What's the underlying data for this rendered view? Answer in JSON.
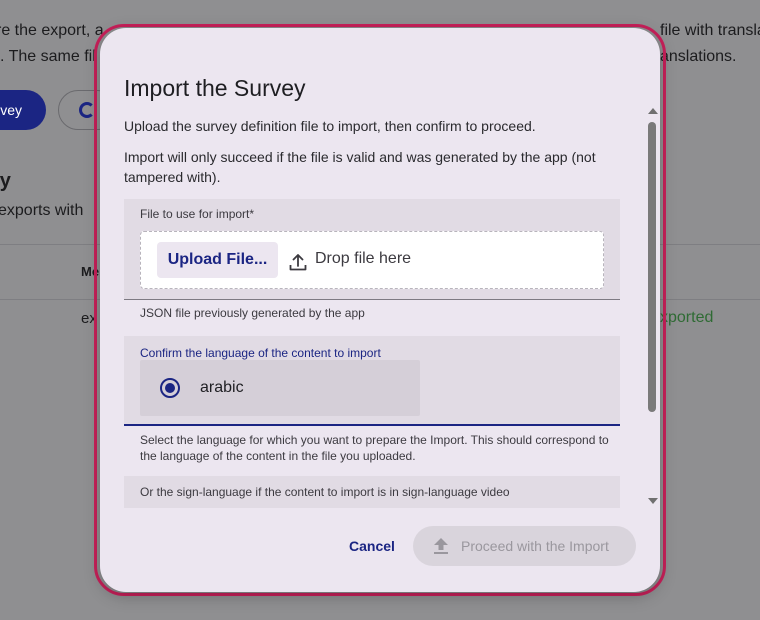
{
  "background": {
    "line1_left": "re the export, a",
    "line1_right": "file with transla",
    "line2_left": ". The same fil",
    "line2_right": "anslations.",
    "survey_button_label": "vey",
    "section_heading": "ry",
    "section_subtitle": "exports with",
    "column_header": "Me",
    "row_cell": "ex",
    "row_status": "xported"
  },
  "dialog": {
    "title": "Import the Survey",
    "intro": "Upload the survey definition file to import, then confirm to proceed.",
    "warning": "Import will only succeed if the file is valid and was generated by the app (not tampered with).",
    "file_field": {
      "label": "File to use for import*",
      "upload_button": "Upload File...",
      "drop_text": "Drop file here",
      "helper": "JSON file previously generated by the app"
    },
    "language_field": {
      "label": "Confirm the language of the content to import",
      "selected_option": "arabic",
      "helper": "Select the language for which you want to prepare the Import. This should correspond to the language of the content in the file you uploaded."
    },
    "sign_language_field": {
      "label": "Or the sign-language if the content to import is in sign-language video"
    },
    "actions": {
      "cancel": "Cancel",
      "proceed": "Proceed with the Import"
    }
  },
  "colors": {
    "accent": "#1b2583",
    "highlight_border": "#c8205a",
    "success_text": "#2f6b34",
    "dialog_bg": "#ece6f0"
  },
  "icons": [
    "upload-icon",
    "radio-selected-icon",
    "upload-arrow-icon",
    "spinner-icon"
  ]
}
